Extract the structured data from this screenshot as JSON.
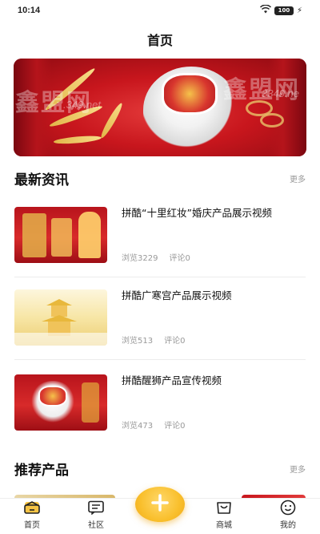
{
  "status_bar": {
    "time": "10:14",
    "battery": "100",
    "wifi_icon": "wifi-icon",
    "charging_icon": "bolt-icon"
  },
  "page": {
    "title": "首页"
  },
  "banner": {
    "watermark_left": "鑫盟网",
    "watermark_right": "鑫盟网",
    "watermark_url_left": ".349.net",
    "watermark_url_right": "3349.ne"
  },
  "latest_news": {
    "title": "最新资讯",
    "more": "更多",
    "items": [
      {
        "title": "拼酷“十里红妆”婚庆产品展示视频",
        "views_label": "浏览3229",
        "comments_label": "评论0"
      },
      {
        "title": "拼酷广寒宫产品展示视频",
        "views_label": "浏览513",
        "comments_label": "评论0"
      },
      {
        "title": "拼酷醒狮产品宣传视频",
        "views_label": "浏览473",
        "comments_label": "评论0"
      }
    ]
  },
  "recommended": {
    "title": "推荐产品",
    "more": "更多"
  },
  "tab_bar": {
    "items": [
      {
        "label": "首页",
        "icon": "home-icon",
        "active": true
      },
      {
        "label": "社区",
        "icon": "community-icon",
        "active": false
      },
      {
        "label": "商城",
        "icon": "shop-bag-icon",
        "active": false
      },
      {
        "label": "我的",
        "icon": "profile-smile-icon",
        "active": false
      }
    ],
    "center_button_icon": "plus-icon"
  },
  "colors": {
    "accent": "#f6c445",
    "banner_red": "#c8161d",
    "text": "#111111",
    "muted": "#999999"
  }
}
